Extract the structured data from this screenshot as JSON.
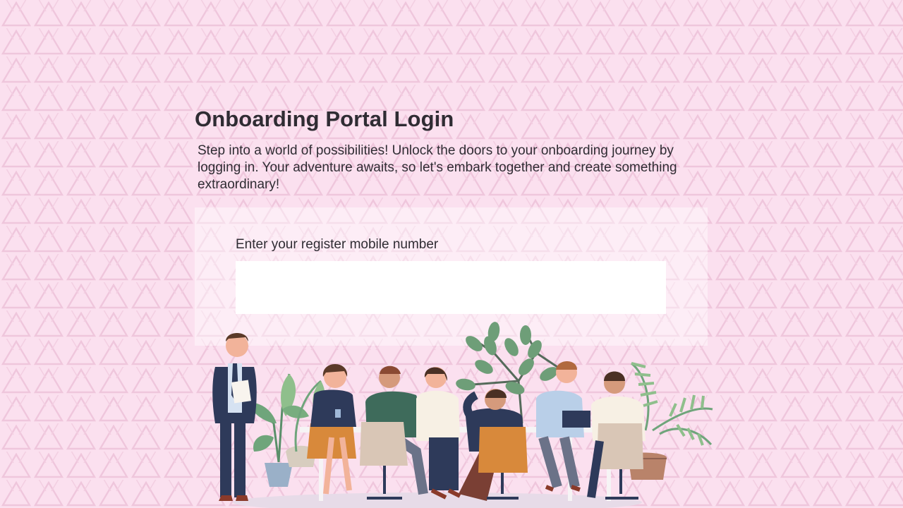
{
  "page": {
    "title": "Onboarding Portal Login",
    "subtitle": "Step into a world of possibilities! Unlock the doors to your onboarding journey by logging in. Your adventure awaits, so let's embark together and create something extraordinary!"
  },
  "form": {
    "mobile_label": "Enter your register mobile number",
    "mobile_value": "",
    "mobile_placeholder": ""
  },
  "icons": {
    "background": "triangle-pattern",
    "illustration": "team-meeting-illustration"
  },
  "colors": {
    "background": "#fbe0ef",
    "text": "#2f2c33",
    "card": "#fdf0f7",
    "input": "#ffffff"
  }
}
